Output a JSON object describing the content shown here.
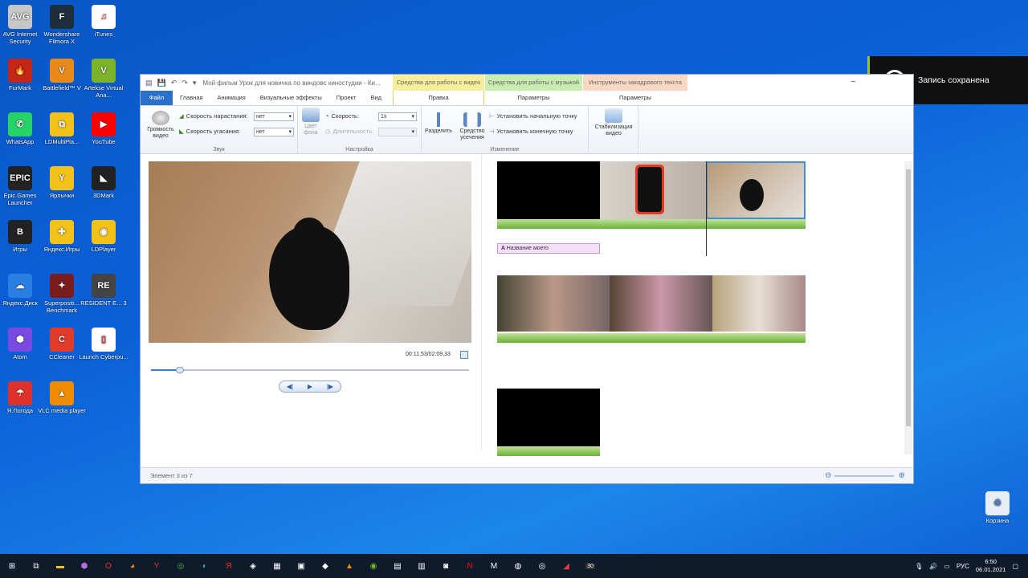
{
  "desktop_left": [
    {
      "label": "AVG Internet Security",
      "color": "#c7c7c7",
      "glyph": "AVG"
    },
    {
      "label": "Wondershare Filmora X",
      "color": "#1d2f3c",
      "glyph": "F"
    },
    {
      "label": "iTunes",
      "color": "#ffffff",
      "glyph": "♫"
    },
    {
      "label": "FurMark",
      "color": "#c4261a",
      "glyph": "🔥"
    },
    {
      "label": "Battlefield™ V",
      "color": "#e8891a",
      "glyph": "V"
    },
    {
      "label": "Artekse Virtual Ana...",
      "color": "#7cb32b",
      "glyph": "V"
    },
    {
      "label": "WhatsApp",
      "color": "#25d366",
      "glyph": "✆"
    },
    {
      "label": "LDMultiPla...",
      "color": "#f2c21a",
      "glyph": "⧉"
    },
    {
      "label": "YouTube",
      "color": "#ff0000",
      "glyph": "▶"
    },
    {
      "label": "Epic Games Launcher",
      "color": "#222",
      "glyph": "EPIC"
    },
    {
      "label": "Ярлычки",
      "color": "#f2c21a",
      "glyph": "Y"
    },
    {
      "label": "3DMark",
      "color": "#222",
      "glyph": "◣"
    },
    {
      "label": "Игры",
      "color": "#222",
      "glyph": "B"
    },
    {
      "label": "Яндекс.Игры",
      "color": "#f2c21a",
      "glyph": "✚"
    },
    {
      "label": "LDPlayer",
      "color": "#f2c21a",
      "glyph": "◉"
    },
    {
      "label": "Яндекс.Диск",
      "color": "#2b7fe2",
      "glyph": "☁"
    },
    {
      "label": "Superpositi... Benchmark",
      "color": "#7a1c1c",
      "glyph": "✦"
    },
    {
      "label": "RESIDENT E... 3",
      "color": "#444",
      "glyph": "RE"
    },
    {
      "label": "Atom",
      "color": "#7a4be0",
      "glyph": "⬢"
    },
    {
      "label": "CCleaner",
      "color": "#e03b2b",
      "glyph": "C"
    },
    {
      "label": "Launch Cyberpu...",
      "color": "#ffffff",
      "glyph": "▯"
    },
    {
      "label": "Я.Погода",
      "color": "#e0302b",
      "glyph": "☂"
    },
    {
      "label": "VLC media player",
      "color": "#f08c00",
      "glyph": "▲"
    }
  ],
  "recycle_bin": "Корзина",
  "notification": "Запись сохранена",
  "window": {
    "title": "Мой фильм Урок для новичка по виндовс киностудии - Ки...",
    "ctx_video_top": "Средства для работы с видео",
    "ctx_video_bot": "Правка",
    "ctx_music_top": "Средства для работы с музыкой",
    "ctx_music_bot": "Параметры",
    "ctx_text_top": "Инструменты закадрового текста",
    "ctx_text_bot": "Параметры",
    "tabs": [
      "Файл",
      "Главная",
      "Анимация",
      "Визуальные эффекты",
      "Проект",
      "Вид"
    ]
  },
  "ribbon": {
    "volume": "Громкость видео",
    "fade_in_label": "Скорость нарастания:",
    "fade_in_value": "нет",
    "fade_out_label": "Скорость угасания:",
    "fade_out_value": "нет",
    "group_sound": "Звук",
    "bg_color": "Цвет фона",
    "speed_label": "Скорость:",
    "speed_value": "1x",
    "duration_label": "Длительность:",
    "group_settings": "Настройка",
    "split": "Разделить",
    "trim": "Средство усечения",
    "set_start": "Установить начальную точку",
    "set_end": "Установить конечную точку",
    "group_edit": "Изменение",
    "stabilize": "Стабилизация видео"
  },
  "player": {
    "time": "00:11,53/02:09,33",
    "progress": 0.09
  },
  "storyboard": {
    "caption": "Название моего"
  },
  "status": "Элемент 3 из 7",
  "taskbar": {
    "lang": "РУС",
    "time": "6:50",
    "date": "06.01.2021",
    "badge": "30"
  },
  "colors": {
    "accent": "#2a6fc9",
    "audio": "#68b234",
    "ctx_video": "#f6ee9a",
    "ctx_music": "#c9ecb0",
    "ctx_text": "#f8d8c4"
  }
}
